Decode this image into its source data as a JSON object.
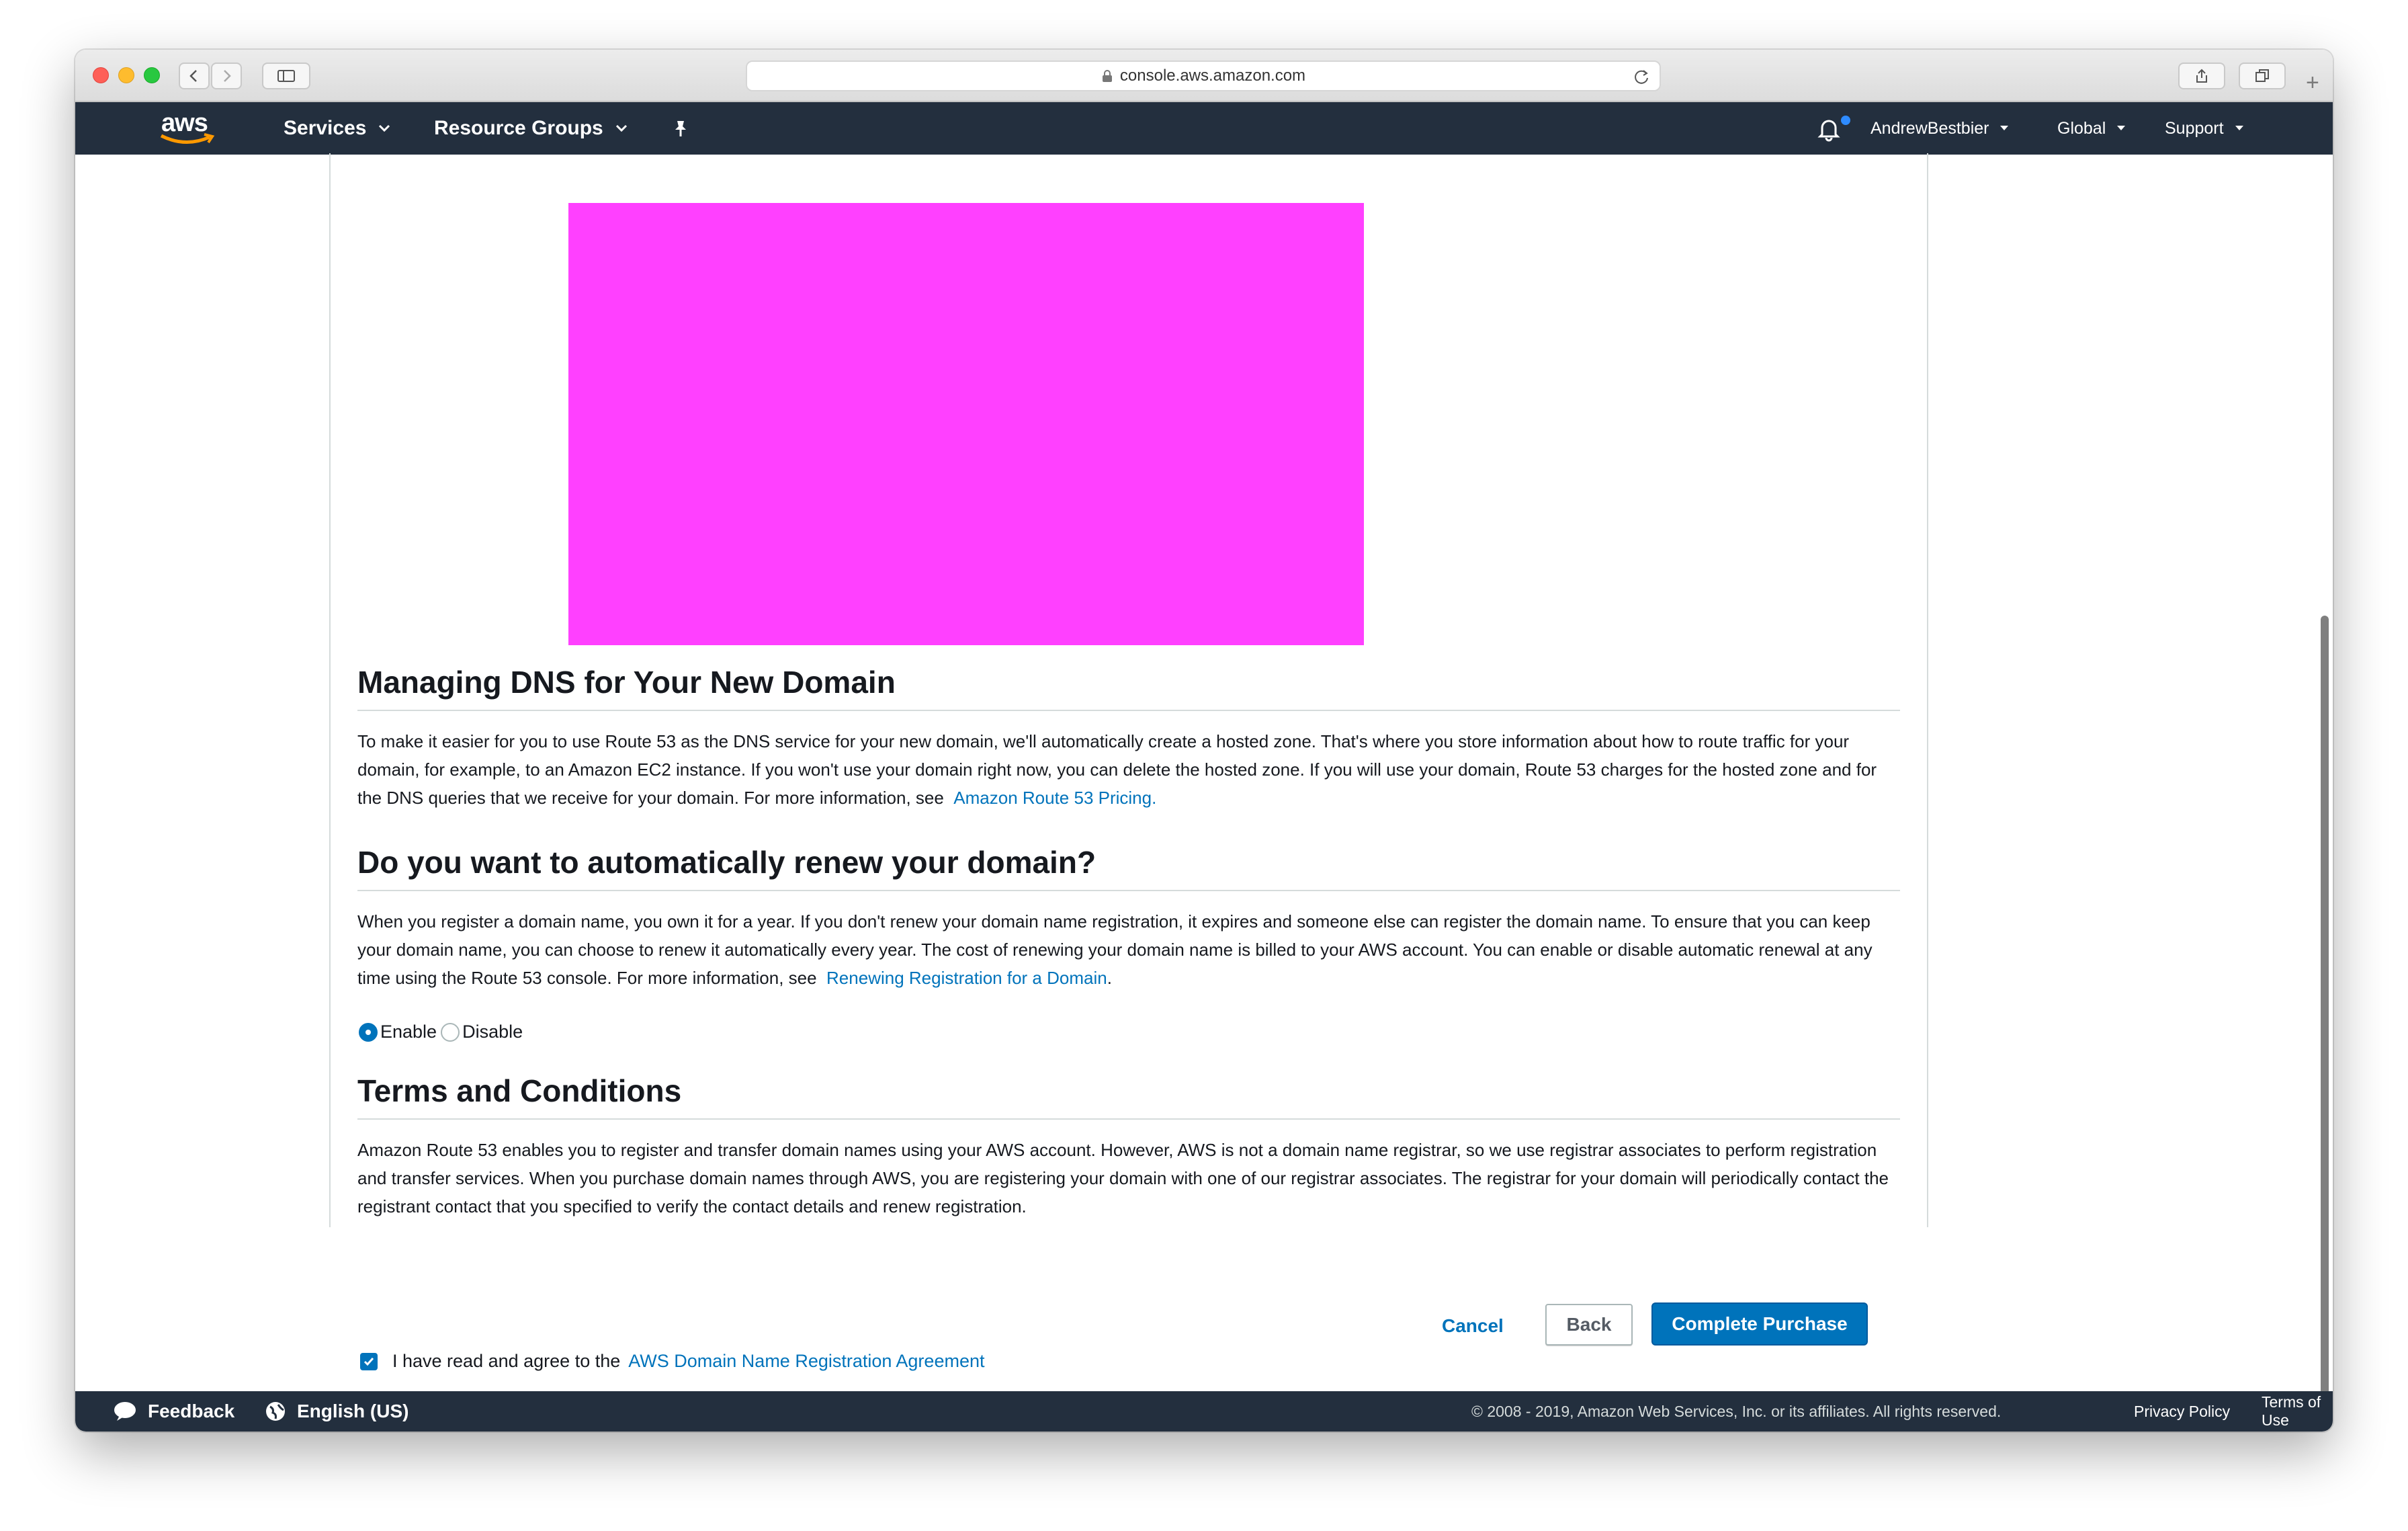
{
  "browser": {
    "url": "console.aws.amazon.com"
  },
  "nav": {
    "logo": "aws",
    "services": "Services",
    "resource_groups": "Resource Groups",
    "user": "AndrewBestbier",
    "region": "Global",
    "support": "Support"
  },
  "sections": {
    "dns": {
      "title": "Managing DNS for Your New Domain",
      "body": "To make it easier for you to use Route 53 as the DNS service for your new domain, we'll automatically create a hosted zone. That's where you store information about how to route traffic for your domain, for example, to an Amazon EC2 instance. If you won't use your domain right now, you can delete the hosted zone. If you will use your domain, Route 53 charges for the hosted zone and for the DNS queries that we receive for your domain. For more information, see",
      "link": "Amazon Route 53 Pricing."
    },
    "renew": {
      "title": "Do you want to automatically renew your domain?",
      "body": "When you register a domain name, you own it for a year. If you don't renew your domain name registration, it expires and someone else can register the domain name. To ensure that you can keep your domain name, you can choose to renew it automatically every year. The cost of renewing your domain name is billed to your AWS account. You can enable or disable automatic renewal at any time using the Route 53 console. For more information, see",
      "link": "Renewing Registration for a Domain",
      "trailing": ".",
      "options": [
        "Enable",
        "Disable"
      ],
      "selected": "Enable"
    },
    "terms": {
      "title": "Terms and Conditions",
      "body": "Amazon Route 53 enables you to register and transfer domain names using your AWS account. However, AWS is not a domain name registrar, so we use registrar associates to perform registration and transfer services. When you purchase domain names through AWS, you are registering your domain with one of our registrar associates. The registrar for your domain will periodically contact the registrant contact that you specified to verify the contact details and renew registration.",
      "agree_text": "I have read and agree to the",
      "agree_link": "AWS Domain Name Registration Agreement",
      "agreed": true
    }
  },
  "actions": {
    "cancel": "Cancel",
    "back": "Back",
    "complete": "Complete Purchase"
  },
  "footer": {
    "feedback": "Feedback",
    "language": "English (US)",
    "copyright": "© 2008 - 2019, Amazon Web Services, Inc. or its affiliates. All rights reserved.",
    "privacy": "Privacy Policy",
    "terms": "Terms of Use"
  },
  "colors": {
    "nav_bg": "#232f3e",
    "link": "#0073bb",
    "primary_button": "#0073bb",
    "banner": "#ff40ff",
    "notification_dot": "#2e8bff"
  }
}
